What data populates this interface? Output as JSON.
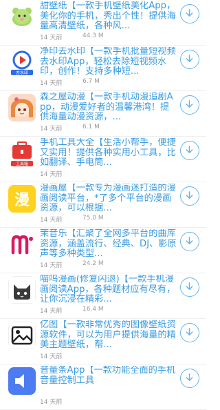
{
  "apps": [
    {
      "title": "甜壁纸【一款手机壁纸美化App，美化你的手机，秀出个性！提供海量高清壁纸，各种风...",
      "time": "14 天前",
      "size": "44.3 M",
      "icon": "bear-icon"
    },
    {
      "title": "净印去水印【一款手机批量短视频去水印App，轻松去除短视频水印，创作！支持多种短...",
      "time": "14 天前",
      "size": "6.7 M",
      "icon": "play-icon"
    },
    {
      "title": "森之屋动漫【一款手机动漫追剧App，动漫爱好者的温馨港湾！提供海量动漫资源，...",
      "time": "14 天前",
      "size": "6.1 M",
      "icon": "anime-girl-icon"
    },
    {
      "title": "手机工具大全【生活小帮手，便捷又实用！提供各种实用小工具，比如翻译、手电筒...",
      "time": "14 天前",
      "size": "",
      "icon": "toolbox-icon"
    },
    {
      "title": "漫画屋【一款专为漫画迷打造的漫画阅读平台，*了多个平台的漫画资源，可以根据...",
      "time": "14 天前",
      "size": "75.0 M",
      "icon": "manga-icon"
    },
    {
      "title": "茉音乐【汇聚了全网多平台的曲库资源，涵盖流行、经典、DJ、影原声等多种类型...",
      "time": "14 天前",
      "size": "24.2 M",
      "icon": "music-icon"
    },
    {
      "title": "喵呜漫画(修复闪退)【一款手机漫画阅读App，各种题材应有尽有，让你沉浸在精彩...",
      "time": "14 天前",
      "size": "16.4 M",
      "icon": "cat-icon"
    },
    {
      "title": "亿图【一款非常优秀的图像壁纸资源软件，可以为用户提供海量的精美主题壁纸，帮...",
      "time": "14 天前",
      "size": "",
      "icon": "landscape-icon"
    },
    {
      "title": "音量条App【一款功能全面的手机音量控制工具",
      "time": "14 天前",
      "size": "",
      "icon": "volume-icon"
    }
  ],
  "icon_texts": {
    "play": "去水印",
    "tools": "工具箱",
    "manga": "漫"
  },
  "colors": {
    "accent": "#3a9be0",
    "meta": "#9a9a9a"
  }
}
